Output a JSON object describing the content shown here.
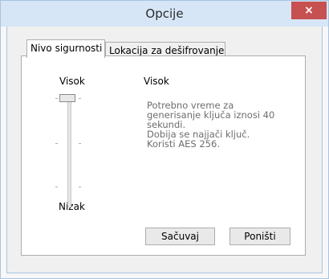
{
  "window": {
    "title": "Opcije",
    "close_symbol": "×",
    "accent_color": "#c75050"
  },
  "tabs": [
    {
      "label": "Nivo sigurnosti",
      "active": true
    },
    {
      "label": "Lokacija za dešifrovanje",
      "active": false
    }
  ],
  "slider": {
    "top_label": "Visok",
    "bottom_label": "Nizak",
    "level": "Visok",
    "value_fraction": 1.0
  },
  "level_panel": {
    "heading": "Visok",
    "description_lines": [
      "Potrebno vreme za",
      "generisanje ključa iznosi 40",
      "sekundi.",
      "Dobija se najjači ključ.",
      "Koristi AES 256."
    ]
  },
  "buttons": {
    "save": "Sačuvaj",
    "cancel": "Poništi"
  }
}
